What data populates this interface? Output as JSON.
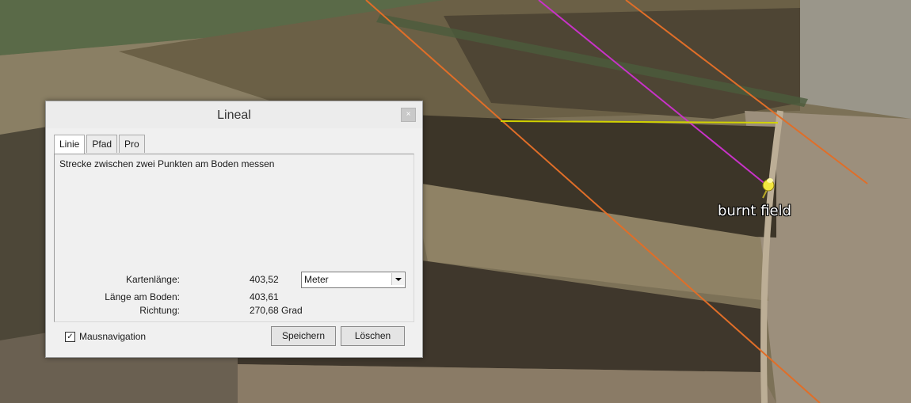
{
  "map": {
    "placemark_label": "burnt field",
    "colors": {
      "path_line": "#d2d200",
      "magenta_line": "#c832c8",
      "orange_line": "#e06e28",
      "placemark": "#f3e640"
    }
  },
  "dialog": {
    "title": "Lineal",
    "close_glyph": "×",
    "tabs": [
      "Linie",
      "Pfad",
      "Pro"
    ],
    "description": "Strecke zwischen zwei Punkten am Boden messen",
    "map_length_label": "Kartenlänge:",
    "map_length_value": "403,52",
    "unit_selected": "Meter",
    "ground_length_label": "Länge am Boden:",
    "ground_length_value": "403,61",
    "heading_label": "Richtung:",
    "heading_value": "270,68 Grad",
    "mouse_nav_label": "Mausnavigation",
    "mouse_nav_checked": true,
    "save_label": "Speichern",
    "delete_label": "Löschen"
  }
}
